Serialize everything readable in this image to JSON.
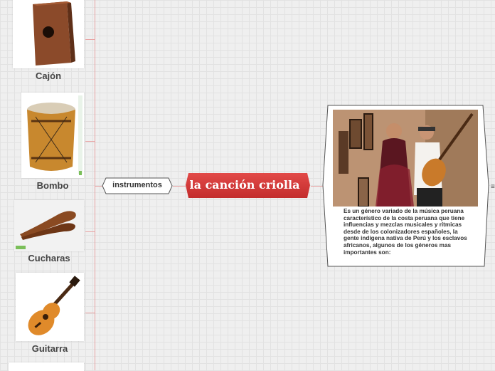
{
  "central_topic": "la canción criolla",
  "branch": "instrumentos",
  "instruments": [
    {
      "name": "Cajón",
      "image_icon": "cajon-drum-photo"
    },
    {
      "name": "Bombo",
      "image_icon": "bombo-drum-photo"
    },
    {
      "name": "Cucharas",
      "image_icon": "spoons-photo"
    },
    {
      "name": "Guitarra",
      "image_icon": "guitar-photo"
    }
  ],
  "description": "Es un género variado de la música peruana característico de la costa peruana que tiene influencias y mezclas musicales y rítmicas desde de los colonizadores españoles, la gente indígena nativa de Perú y los esclavos africanos, algunos de los géneros mas importantes son:",
  "description_image": "dancers-with-guitar-photo",
  "colors": {
    "accent": "#d43a3a",
    "connector": "#e8a3a3",
    "text": "#444444"
  }
}
